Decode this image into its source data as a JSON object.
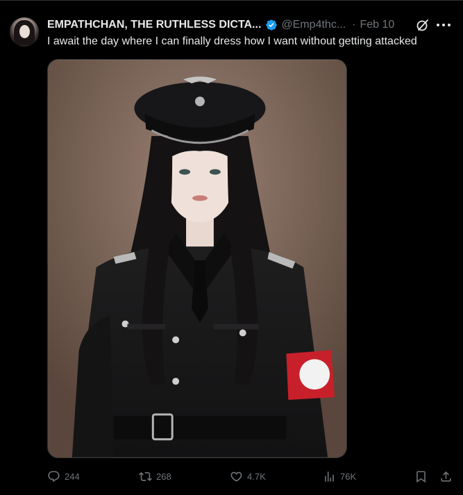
{
  "tweet": {
    "display_name": "EMPATHCHAN, THE RUTHLESS DICTA...",
    "handle": "@Emp4thc...",
    "separator": "·",
    "date": "Feb 10",
    "text": "I await the day where I can finally dress how I want without getting attacked",
    "verified": true,
    "accent_color": "#1d9bf0"
  },
  "media": {
    "icon": "photo"
  },
  "actions": {
    "reply_count": "244",
    "retweet_count": "268",
    "like_count": "4.7K",
    "view_count": "76K"
  },
  "colors": {
    "background": "#000000",
    "text_primary": "#e7e9ea",
    "text_secondary": "#71767b",
    "divider": "#2f3336",
    "verified": "#1d9bf0",
    "armband_red": "#c8202a"
  }
}
